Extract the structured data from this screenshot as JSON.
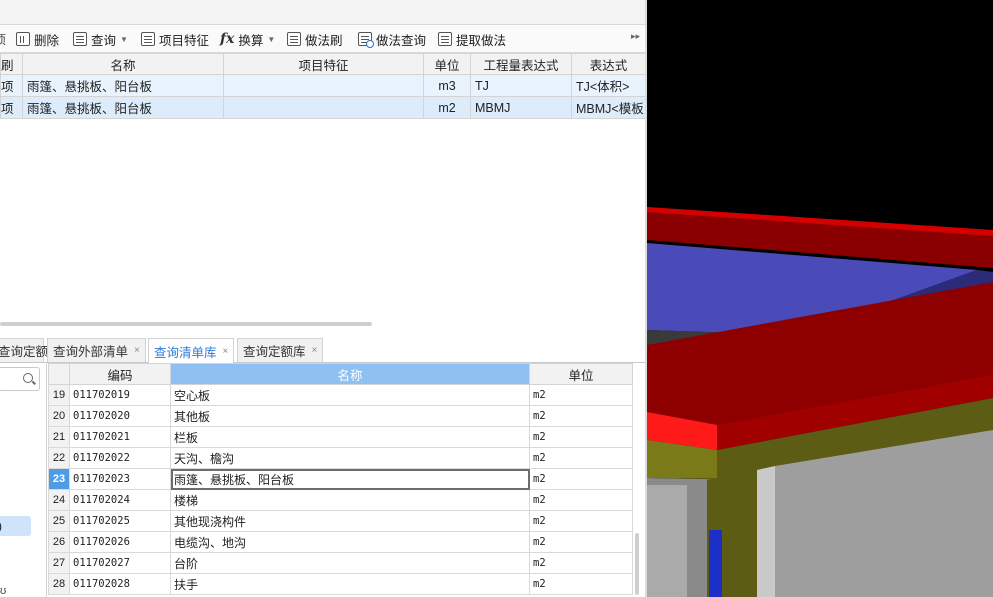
{
  "toolbar": {
    "delete_label": "删除",
    "query_label": "查询",
    "feature_label": "项目特征",
    "convert_label": "换算",
    "method_brush_label": "做法刷",
    "method_query_label": "做法查询",
    "extract_method_label": "提取做法"
  },
  "main_grid": {
    "headers": [
      "刷",
      "名称",
      "项目特征",
      "单位",
      "工程量表达式",
      "表达式"
    ],
    "rows": [
      {
        "c0": "项",
        "name": "雨篷、悬挑板、阳台板",
        "feature": "",
        "unit": "m3",
        "expr": "TJ",
        "expr_desc": "TJ<体积>"
      },
      {
        "c0": "项",
        "name": "雨篷、悬挑板、阳台板",
        "feature": "",
        "unit": "m2",
        "expr": "MBMJ",
        "expr_desc": "MBMJ<模板"
      }
    ]
  },
  "bottom_tabs": [
    {
      "label": "查询定额",
      "active": false
    },
    {
      "label": "查询外部清单",
      "active": false
    },
    {
      "label": "查询清单库",
      "active": true
    },
    {
      "label": "查询定额库",
      "active": false
    }
  ],
  "left_pane": {
    "selected_fragment": ")",
    "bottom_fragment": "ʊ"
  },
  "query_grid": {
    "headers": {
      "code": "编码",
      "name": "名称",
      "unit": "单位"
    },
    "rows": [
      {
        "num": "19",
        "code": "011702019",
        "name": "空心板",
        "unit": "m2"
      },
      {
        "num": "20",
        "code": "011702020",
        "name": "其他板",
        "unit": "m2"
      },
      {
        "num": "21",
        "code": "011702021",
        "name": "栏板",
        "unit": "m2"
      },
      {
        "num": "22",
        "code": "011702022",
        "name": "天沟、檐沟",
        "unit": "m2"
      },
      {
        "num": "23",
        "code": "011702023",
        "name": "雨篷、悬挑板、阳台板",
        "unit": "m2"
      },
      {
        "num": "24",
        "code": "011702024",
        "name": "楼梯",
        "unit": "m2"
      },
      {
        "num": "25",
        "code": "011702025",
        "name": "其他现浇构件",
        "unit": "m2"
      },
      {
        "num": "26",
        "code": "011702026",
        "name": "电缆沟、地沟",
        "unit": "m2"
      },
      {
        "num": "27",
        "code": "011702027",
        "name": "台阶",
        "unit": "m2"
      },
      {
        "num": "28",
        "code": "011702028",
        "name": "扶手",
        "unit": "m2"
      }
    ]
  },
  "colors": {
    "accent_blue": "#2a7ad9",
    "header_highlight": "#8fc0f2",
    "selected_row": "#e8f3fd",
    "model_red": "#e00000",
    "model_blue_slab": "#4a4ab8"
  }
}
